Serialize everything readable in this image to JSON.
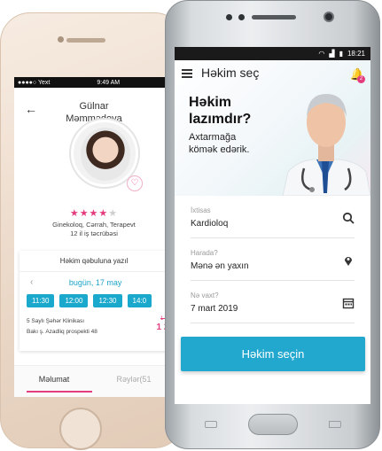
{
  "iphone": {
    "status": {
      "carrier": "●●●●○ Yext",
      "time": "9:49 AM",
      "battery": "▮"
    },
    "back_icon": "←",
    "doctor_name_first": "Gülnar",
    "doctor_name_last": "Məmmədova",
    "rating": {
      "filled": "★★★★",
      "empty": "★",
      "value": 4,
      "max": 5
    },
    "specialties": "Ginekoloq, Cərrah, Terapevt",
    "experience": "12 il iş təcrübəsi",
    "appointment": {
      "title": "Həkim qəbuluna yazıl",
      "prev": "‹",
      "date": "bugün, 17 may",
      "times": [
        "11:30",
        "12:00",
        "12:30",
        "14:0"
      ]
    },
    "clinic": {
      "name": "5 Saylı Şəhər Klinikası",
      "address": "Bakı ş. Azadliq prospekti 48",
      "old_price": "1 500",
      "new_price": "1 28"
    },
    "tabs": [
      {
        "label": "Məlumat"
      },
      {
        "label": "Rəylər(51"
      }
    ]
  },
  "android": {
    "status": {
      "time": "18:21"
    },
    "app_title": "Həkim seç",
    "notification_count": "2",
    "hero_heading_line1": "Həkim",
    "hero_heading_line2": "lazımdır?",
    "hero_sub_line1": "Axtarmağa",
    "hero_sub_line2": "kömək edərik.",
    "fields": [
      {
        "label": "İxtisas",
        "value": "Kardioloq",
        "icon": "search-icon"
      },
      {
        "label": "Harada?",
        "value": "Mənə ən yaxın",
        "icon": "location-pin-icon"
      },
      {
        "label": "Nə vaxt?",
        "value": "7 mart 2019",
        "icon": "calendar-icon"
      }
    ],
    "cta_label": "Həkim seçin"
  },
  "colors": {
    "accent": "#22a8cf",
    "pink": "#e23d7e"
  }
}
